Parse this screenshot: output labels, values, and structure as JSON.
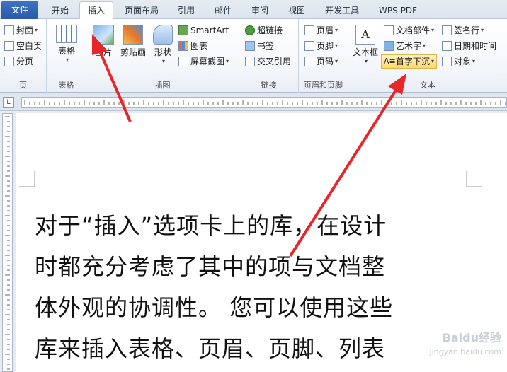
{
  "tabs": [
    {
      "label": "文件"
    },
    {
      "label": "开始"
    },
    {
      "label": "插入"
    },
    {
      "label": "页面布局"
    },
    {
      "label": "引用"
    },
    {
      "label": "邮件"
    },
    {
      "label": "审阅"
    },
    {
      "label": "视图"
    },
    {
      "label": "开发工具"
    },
    {
      "label": "WPS PDF"
    }
  ],
  "ribbon": {
    "page_group": {
      "label": "页",
      "cover": "封面",
      "blank": "空白页",
      "break": "分页"
    },
    "table_group": {
      "label": "表格",
      "table": "表格"
    },
    "illus_group": {
      "label": "插图",
      "picture": "图片",
      "clipart": "剪贴画",
      "shapes": "形状",
      "smartart": "SmartArt",
      "chart": "图表",
      "screenshot": "屏幕截图"
    },
    "links_group": {
      "label": "链接",
      "hyperlink": "超链接",
      "bookmark": "书签",
      "crossref": "交叉引用"
    },
    "hf_group": {
      "label": "页眉和页脚",
      "header": "页眉",
      "footer": "页脚",
      "pagenum": "页码"
    },
    "text_group": {
      "label": "文本",
      "textbox": "文本框",
      "quickparts": "文档部件",
      "wordart": "艺术字",
      "dropcap": "首字下沉",
      "sigline": "签名行",
      "datetime": "日期和时间",
      "object": "对象"
    }
  },
  "document": {
    "lines": [
      "对于“插入”选项卡上的库，在设计",
      "时都充分考虑了其中的项与文档整",
      "体外观的协调性。 您可以使用这些",
      "库来插入表格、页眉、页脚、列表"
    ]
  },
  "colors": {
    "accent": "#2a5aa8",
    "arrow": "#e8262a"
  },
  "watermark": {
    "brand": "Baidu经验",
    "url": "jingyan.baidu.com"
  }
}
